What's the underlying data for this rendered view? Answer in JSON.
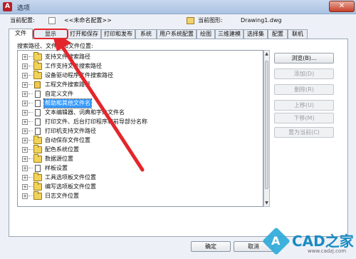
{
  "window": {
    "title": "选项",
    "app_icon_letter": "A",
    "close_glyph": "✕"
  },
  "info": {
    "current_profile_label": "当前配置:",
    "current_profile_value": "<<未命名配置>>",
    "current_drawing_label": "当前图形:",
    "current_drawing_value": "Drawing1.dwg"
  },
  "tabs": [
    {
      "label": "文件",
      "active": true
    },
    {
      "label": "显示",
      "highlighted": true
    },
    {
      "label": "打开和保存"
    },
    {
      "label": "打印和发布"
    },
    {
      "label": "系统"
    },
    {
      "label": "用户系统配置"
    },
    {
      "label": "绘图"
    },
    {
      "label": "三维建模"
    },
    {
      "label": "选择集"
    },
    {
      "label": "配置"
    },
    {
      "label": "联机"
    }
  ],
  "search_paths_label": "搜索路径、文件名和文件位置:",
  "tree_items": [
    {
      "label": "支持文件搜索路径",
      "icon": "folder-icon"
    },
    {
      "label": "工作支持文件搜索路径",
      "icon": "folder-icon"
    },
    {
      "label": "设备驱动程序文件搜索路径",
      "icon": "folder-icon"
    },
    {
      "label": "工程文件搜索路径",
      "icon": "document-yellow-icon"
    },
    {
      "label": "自定义文件",
      "icon": "document-icon"
    },
    {
      "label": "帮助和其他文件名",
      "icon": "document-icon",
      "selected": true
    },
    {
      "label": "文本编辑器、词典和字体文件名",
      "icon": "document-icon"
    },
    {
      "label": "打印文件、后台打印程序和前导部分名称",
      "icon": "document-icon"
    },
    {
      "label": "打印机支持文件路径",
      "icon": "document-icon"
    },
    {
      "label": "自动保存文件位置",
      "icon": "folder-icon"
    },
    {
      "label": "配色系统位置",
      "icon": "folder-icon"
    },
    {
      "label": "数据源位置",
      "icon": "folder-icon"
    },
    {
      "label": "样板设置",
      "icon": "document-icon"
    },
    {
      "label": "工具选项板文件位置",
      "icon": "folder-icon"
    },
    {
      "label": "编写选项板文件位置",
      "icon": "folder-icon"
    },
    {
      "label": "日志文件位置",
      "icon": "folder-icon"
    }
  ],
  "side_buttons": [
    {
      "label": "浏览(B)...",
      "enabled": true
    },
    {
      "label": "添加(D)",
      "enabled": false
    },
    {
      "label": "删除(R)",
      "enabled": false
    },
    {
      "label": "上移(U)",
      "enabled": false
    },
    {
      "label": "下移(M)",
      "enabled": false
    },
    {
      "label": "置为当前(C)",
      "enabled": false
    }
  ],
  "bottom_buttons": {
    "ok": "确定",
    "cancel": "取消"
  },
  "watermark": {
    "logo_letter": "A",
    "text": "CAD之家",
    "url": "www.cadzj.com"
  },
  "colors": {
    "highlight_red": "#e3262b",
    "selection_blue": "#3399ff",
    "tab_border": "#9aa6b6"
  }
}
